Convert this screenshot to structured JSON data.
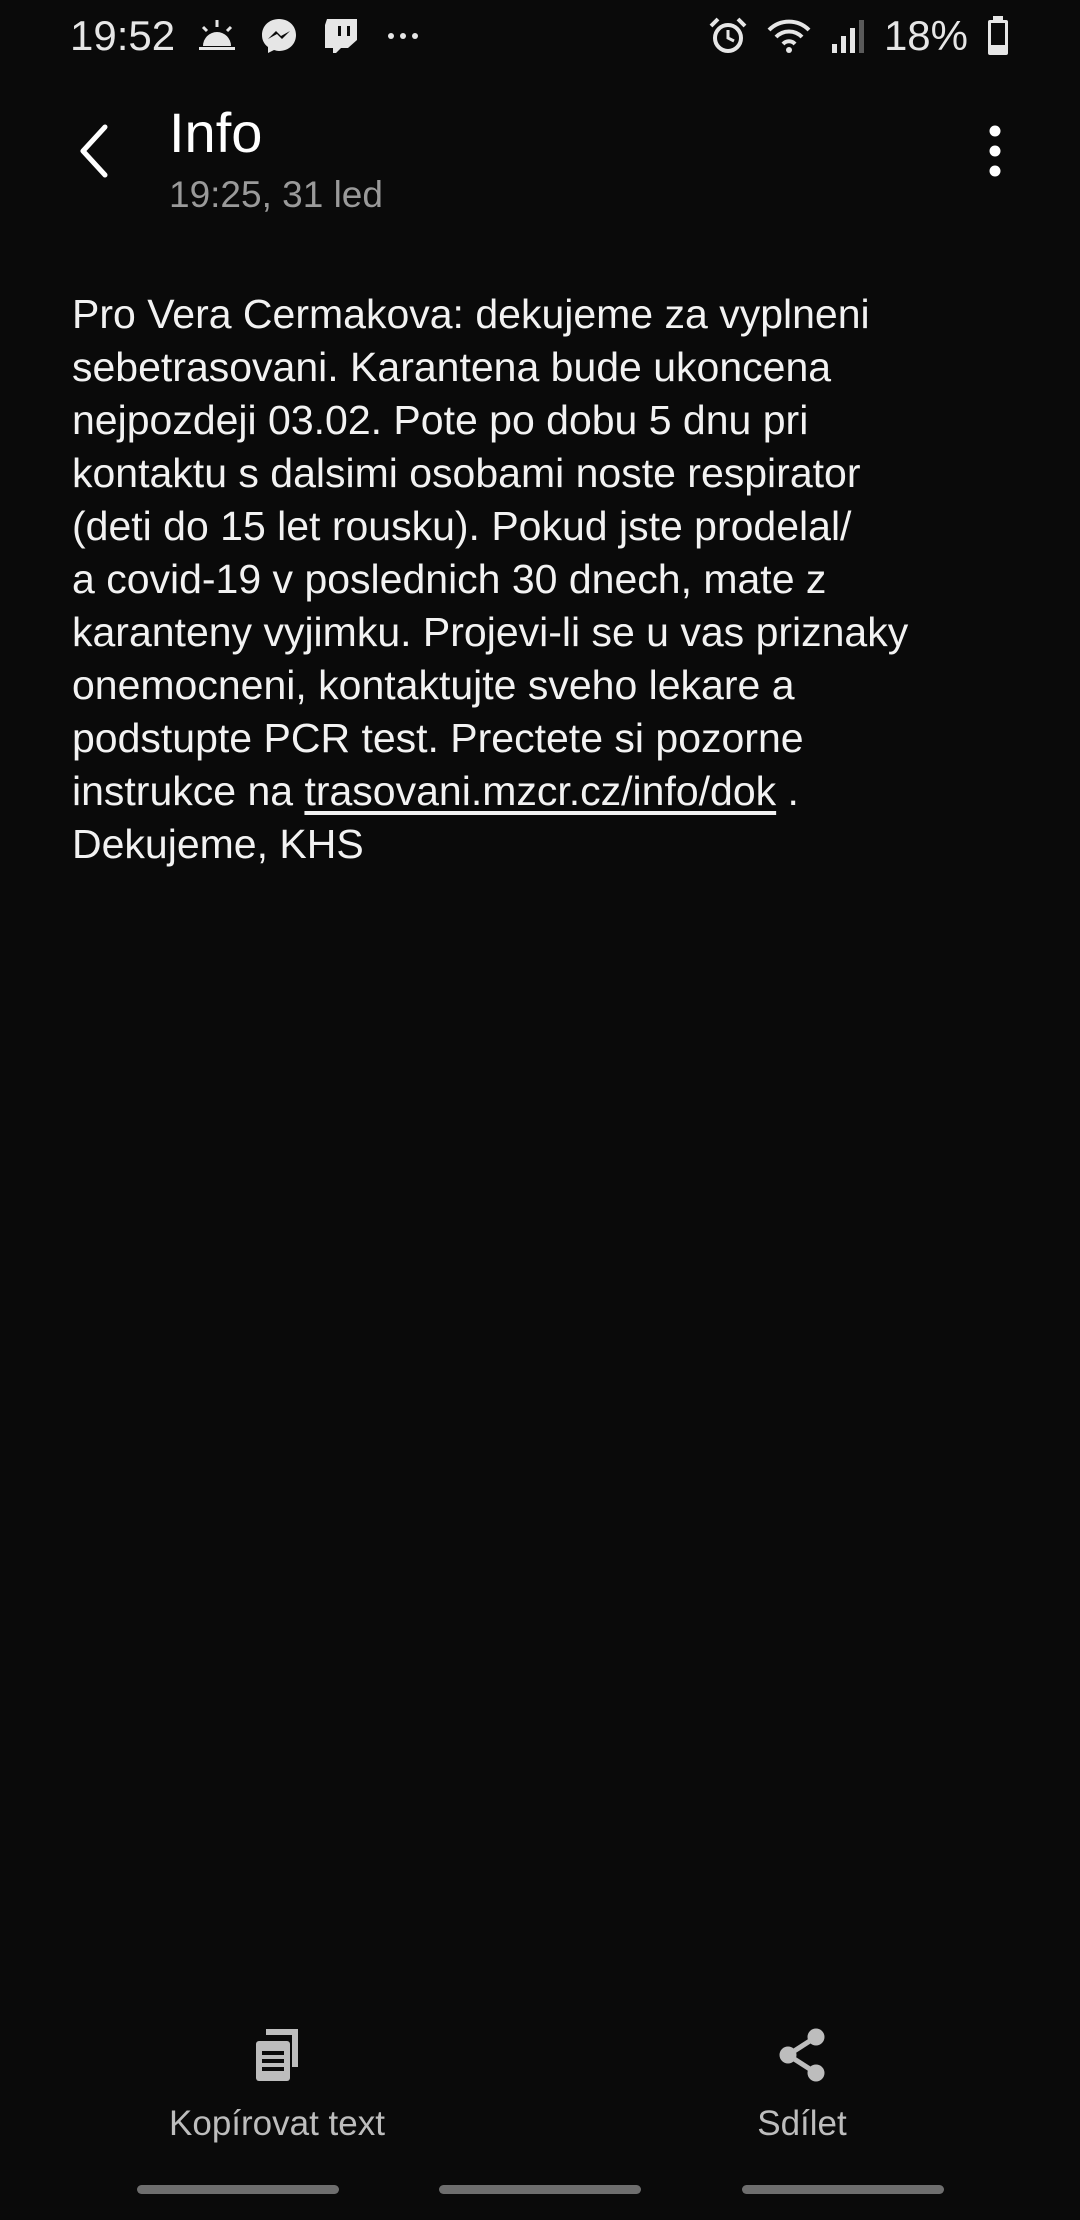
{
  "status_bar": {
    "time": "19:52",
    "icons_left": [
      "weather-sunrise-icon",
      "messenger-icon",
      "twitch-icon",
      "more-notifications-icon"
    ],
    "icons_right": [
      "alarm-icon",
      "wifi-icon",
      "signal-icon",
      "battery-icon"
    ],
    "battery_percent": "18%"
  },
  "header": {
    "title": "Info",
    "subtitle": "19:25, 31 led",
    "back_icon": "back-arrow-icon",
    "more_icon": "more-vertical-icon"
  },
  "message": {
    "lines": [
      "Pro Vera Cermakova: dekujeme za vyplneni",
      "sebetrasovani. Karantena bude ukoncena",
      "nejpozdeji 03.02. Pote po dobu 5 dnu pri",
      "kontaktu s dalsimi osobami noste respirator",
      "(deti do 15 let rousku). Pokud jste prodelal/",
      "a covid-19 v poslednich 30 dnech, mate z",
      "karanteny vyjimku. Projevi-li se u vas priznaky",
      "onemocneni, kontaktujte sveho lekare a",
      "podstupte PCR test. Prectete si pozorne"
    ],
    "link_prefix": "instrukce na ",
    "link_text": "trasovani.mzcr.cz/info/dok",
    "link_suffix": " .",
    "last_line": "Dekujeme, KHS"
  },
  "bottom_bar": {
    "copy_label": "Kopírovat text",
    "share_label": "Sdílet",
    "copy_icon": "copy-text-icon",
    "share_icon": "share-icon"
  },
  "colors": {
    "background": "#0a0a0a",
    "text": "#f2f2f2",
    "subtitle": "#9a9a9a",
    "action_label": "#bdbdbd"
  }
}
